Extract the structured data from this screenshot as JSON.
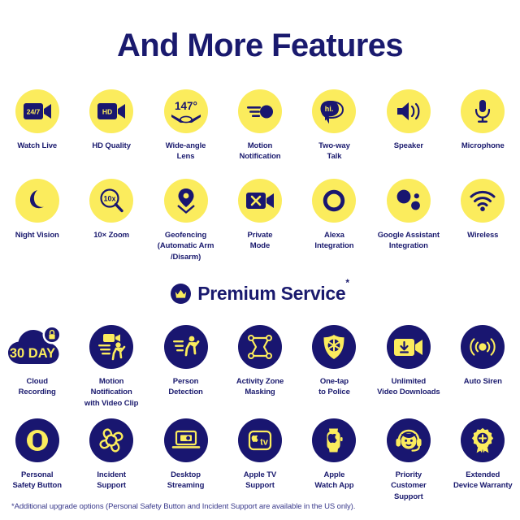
{
  "header": {
    "title": "And More Features"
  },
  "premium": {
    "title": "Premium Service",
    "asterisk": "*",
    "icon": "crown-icon"
  },
  "features": [
    {
      "label": "Watch Live",
      "icon": "camera-247-icon",
      "style": "yellow"
    },
    {
      "label": "HD Quality",
      "icon": "camera-hd-icon",
      "style": "yellow"
    },
    {
      "label": "Wide-angle\nLens",
      "icon": "wide-angle-lens-icon",
      "style": "yellow",
      "value": "147°"
    },
    {
      "label": "Motion\nNotification",
      "icon": "motion-notification-icon",
      "style": "yellow"
    },
    {
      "label": "Two-way\nTalk",
      "icon": "two-way-talk-icon",
      "style": "yellow",
      "value": "hi."
    },
    {
      "label": "Speaker",
      "icon": "speaker-icon",
      "style": "yellow"
    },
    {
      "label": "Microphone",
      "icon": "microphone-icon",
      "style": "yellow"
    },
    {
      "label": "Night Vision",
      "icon": "moon-icon",
      "style": "yellow"
    },
    {
      "label": "10× Zoom",
      "icon": "magnifier-zoom-icon",
      "style": "yellow",
      "value": "10x"
    },
    {
      "label": "Geofencing\n(Automatic Arm\n/Disarm)",
      "icon": "map-pin-geofence-icon",
      "style": "yellow"
    },
    {
      "label": "Private\nMode",
      "icon": "camera-off-icon",
      "style": "yellow"
    },
    {
      "label": "Alexa\nIntegration",
      "icon": "alexa-ring-icon",
      "style": "yellow"
    },
    {
      "label": "Google Assistant\nIntegration",
      "icon": "google-assistant-dots-icon",
      "style": "yellow"
    },
    {
      "label": "Wireless",
      "icon": "wifi-icon",
      "style": "yellow"
    }
  ],
  "premium_features": [
    {
      "label": "Cloud\nRecording",
      "icon": "cloud-lock-icon",
      "style": "clear",
      "value": "30 DAY"
    },
    {
      "label": "Motion\nNotification\nwith Video Clip",
      "icon": "motion-video-clip-icon",
      "style": "navy"
    },
    {
      "label": "Person\nDetection",
      "icon": "person-running-icon",
      "style": "navy"
    },
    {
      "label": "Activity Zone\nMasking",
      "icon": "activity-zone-icon",
      "style": "navy"
    },
    {
      "label": "One-tap\nto Police",
      "icon": "police-badge-icon",
      "style": "navy"
    },
    {
      "label": "Unlimited\nVideo Downloads",
      "icon": "video-download-icon",
      "style": "navy"
    },
    {
      "label": "Auto Siren",
      "icon": "siren-icon",
      "style": "navy"
    },
    {
      "label": "Personal\nSafety Button",
      "icon": "safety-button-icon",
      "style": "navy"
    },
    {
      "label": "Incident\nSupport",
      "icon": "incident-support-icon",
      "style": "navy"
    },
    {
      "label": "Desktop\nStreaming",
      "icon": "laptop-streaming-icon",
      "style": "navy"
    },
    {
      "label": "Apple TV\nSupport",
      "icon": "apple-tv-icon",
      "style": "navy"
    },
    {
      "label": "Apple\nWatch App",
      "icon": "apple-watch-icon",
      "style": "navy"
    },
    {
      "label": "Priority\nCustomer\nSupport",
      "icon": "headset-support-icon",
      "style": "navy"
    },
    {
      "label": "Extended\nDevice Warranty",
      "icon": "warranty-ribbon-icon",
      "style": "navy"
    }
  ],
  "footnote": "*Additional upgrade options (Personal Safety Button and Incident Support are available in the US only).",
  "colors": {
    "yellow": "#fbec5d",
    "navy": "#191670",
    "text": "#1a1a6e",
    "background": "#ffffff"
  }
}
